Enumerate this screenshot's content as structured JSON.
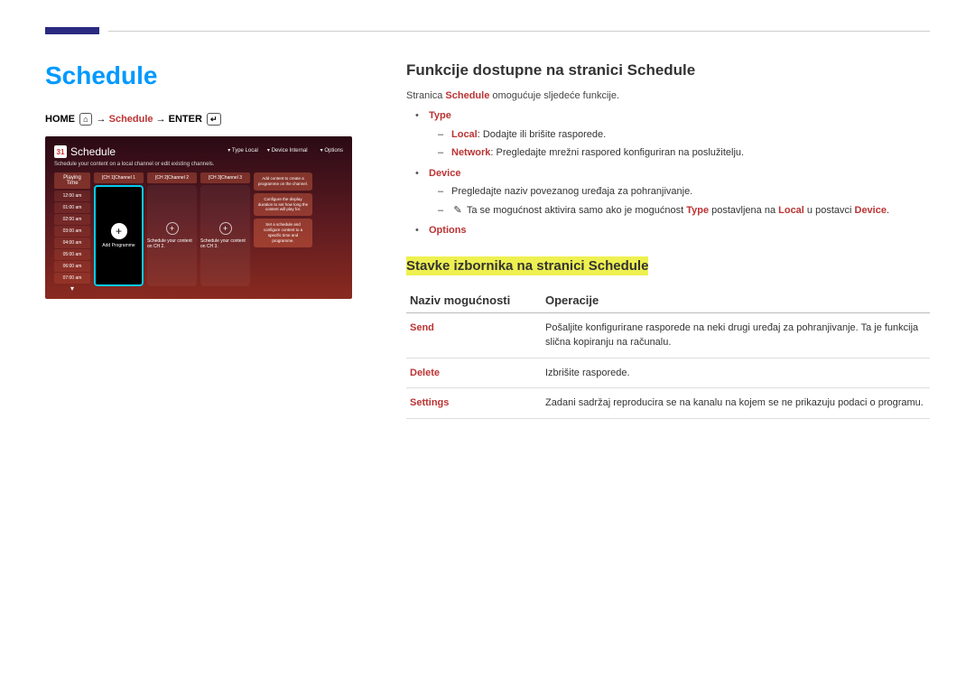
{
  "page_title": "Schedule",
  "path": {
    "home": "HOME",
    "schedule": "Schedule",
    "enter": "ENTER"
  },
  "tv": {
    "title": "Schedule",
    "calendar_icon": "31",
    "subtitle": "Schedule your content on a local channel or edit existing channels.",
    "controls": {
      "type": "Type Local",
      "device": "Device Internal",
      "options": "Options"
    },
    "time_header": "Playing Time",
    "times": [
      "12:00 am",
      "01:00 am",
      "02:00 am",
      "03:00 am",
      "04:00 am",
      "05:00 am",
      "06:00 am",
      "07:00 am"
    ],
    "channels": [
      {
        "name": "[CH 1]Channel 1",
        "label": "Add Programme"
      },
      {
        "name": "[CH 2]Channel 2",
        "label": "Schedule your content on CH 2."
      },
      {
        "name": "[CH 3]Channel 3",
        "label": "Schedule your content on CH 3."
      }
    ],
    "side": [
      "Add content to create a programme on the channel.",
      "Configure the display duration to set how long the content will play for.",
      "Set a schedule and configure content to a specific time and programme."
    ]
  },
  "right": {
    "heading": "Funkcije dostupne na stranici Schedule",
    "intro_pre": "Stranica ",
    "intro_highlight": "Schedule",
    "intro_post": " omogućuje sljedeće funkcije.",
    "features": {
      "type": "Type",
      "type_sub": [
        {
          "bold": "Local",
          "text": ": Dodajte ili brišite rasporede."
        },
        {
          "bold": "Network",
          "text": ": Pregledajte mrežni raspored konfiguriran na poslužitelju."
        }
      ],
      "device": "Device",
      "device_sub1": "Pregledajte naziv povezanog uređaja za pohranjivanje.",
      "device_note_pre": "Ta se mogućnost aktivira samo ako je mogućnost ",
      "device_note_type": "Type",
      "device_note_mid": " postavljena na ",
      "device_note_local": "Local",
      "device_note_mid2": " u postavci ",
      "device_note_device": "Device",
      "device_note_end": ".",
      "options": "Options"
    },
    "subheading": "Stavke izbornika na stranici Schedule",
    "table": {
      "col1": "Naziv mogućnosti",
      "col2": "Operacije",
      "rows": [
        {
          "name": "Send",
          "desc": "Pošaljite konfigurirane rasporede na neki drugi uređaj za pohranjivanje. Ta je funkcija slična kopiranju na računalu."
        },
        {
          "name": "Delete",
          "desc": "Izbrišite rasporede."
        },
        {
          "name": "Settings",
          "desc": "Zadani sadržaj reproducira se na kanalu na kojem se ne prikazuju podaci o programu."
        }
      ]
    }
  }
}
